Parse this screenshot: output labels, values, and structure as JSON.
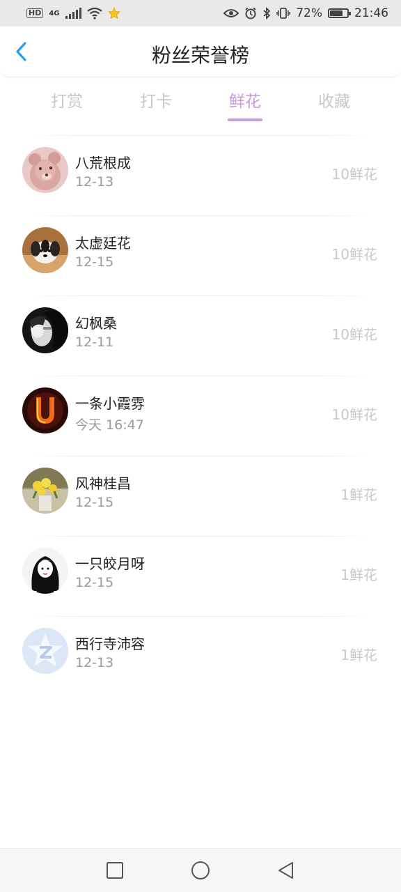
{
  "status_bar": {
    "hd": "HD",
    "network": "4G",
    "battery": "72%",
    "time": "21:46"
  },
  "header": {
    "title": "粉丝荣誉榜"
  },
  "tabs": [
    {
      "label": "打赏",
      "active": false
    },
    {
      "label": "打卡",
      "active": false
    },
    {
      "label": "鲜花",
      "active": true
    },
    {
      "label": "收藏",
      "active": false
    }
  ],
  "fans": [
    {
      "name": "八荒根成",
      "date": "12-13",
      "amount": "10鲜花",
      "avatar": "pink-teddy-bear"
    },
    {
      "name": "太虚廷花",
      "date": "12-15",
      "amount": "10鲜花",
      "avatar": "puppy"
    },
    {
      "name": "幻枫桑",
      "date": "12-11",
      "amount": "10鲜花",
      "avatar": "black-white-portrait"
    },
    {
      "name": "一条小霞雰",
      "date": "今天 16:47",
      "amount": "10鲜花",
      "avatar": "fire-letter-u"
    },
    {
      "name": "风神桂昌",
      "date": "12-15",
      "amount": "1鲜花",
      "avatar": "yellow-flowers"
    },
    {
      "name": "一只皎月呀",
      "date": "12-15",
      "amount": "1鲜花",
      "avatar": "girl-sketch"
    },
    {
      "name": "西行寺沛容",
      "date": "12-13",
      "amount": "1鲜花",
      "avatar": "qq-default"
    }
  ],
  "colors": {
    "accent": "#c59be0",
    "back": "#2e9ce8",
    "muted": "#c7c7c7"
  }
}
